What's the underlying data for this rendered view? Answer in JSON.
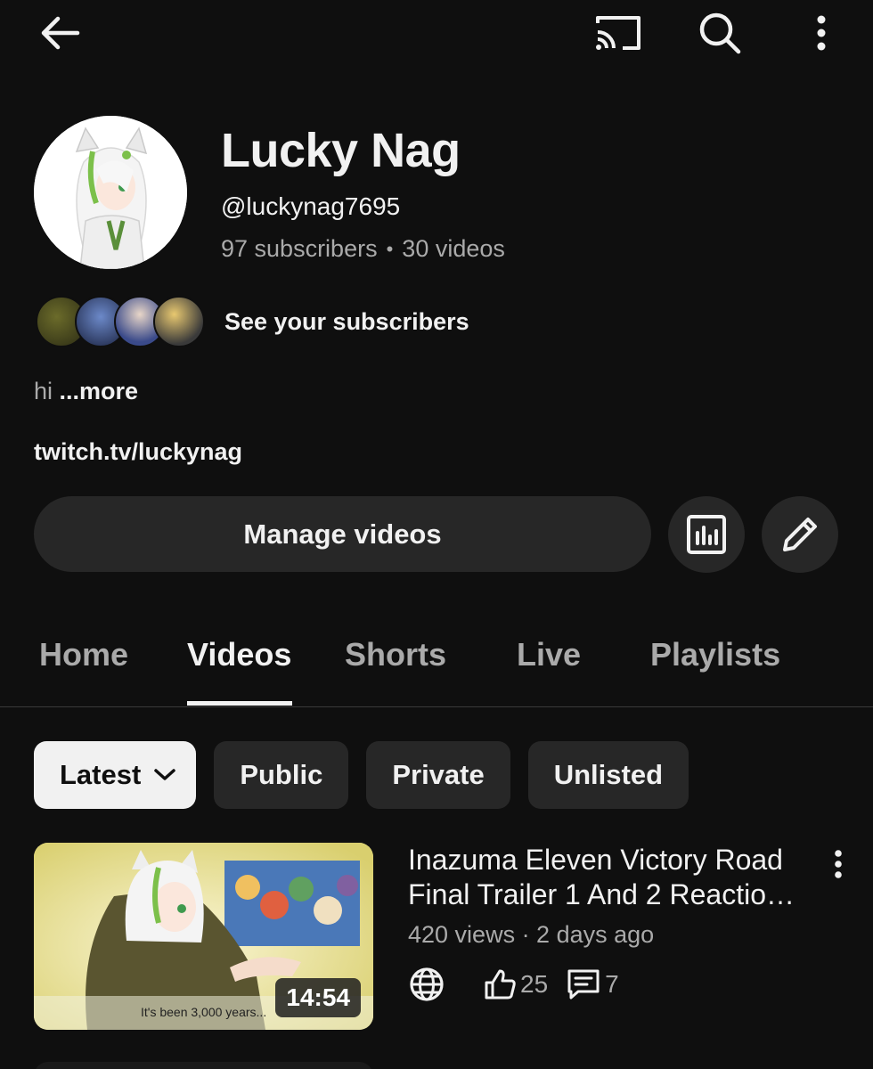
{
  "topbar": {
    "back_icon": "arrow-left-icon",
    "cast_icon": "cast-icon",
    "search_icon": "search-icon",
    "more_icon": "more-vertical-icon"
  },
  "channel": {
    "name": "Lucky Nag",
    "handle": "@luckynag7695",
    "subscribers": "97 subscribers",
    "separator": "•",
    "videos": "30 videos",
    "see_subscribers": "See your subscribers",
    "description": "hi",
    "more_label": "...more",
    "link": "twitch.tv/luckynag"
  },
  "actions": {
    "manage_videos": "Manage videos",
    "analytics_icon": "analytics-icon",
    "edit_icon": "pencil-icon"
  },
  "tabs": [
    {
      "label": "Home"
    },
    {
      "label": "Videos",
      "active": true
    },
    {
      "label": "Shorts"
    },
    {
      "label": "Live"
    },
    {
      "label": "Playlists"
    }
  ],
  "chips": {
    "sort": "Latest",
    "public": "Public",
    "private": "Private",
    "unlisted": "Unlisted"
  },
  "videos": [
    {
      "title_line1": "Inazuma Eleven Victory Road",
      "title_line2": "Final Trailer 1 And 2 Reactio…",
      "meta": "420 views · 2 days ago",
      "duration": "14:54",
      "thumb_caption": "It's been 3,000 years...",
      "likes": "25",
      "comments": "7",
      "visibility_icon": "globe-icon"
    }
  ],
  "colors": {
    "background": "#0f0f0f",
    "surface": "#272727",
    "text_primary": "#f1f1f1",
    "text_secondary": "#aaaaaa"
  }
}
